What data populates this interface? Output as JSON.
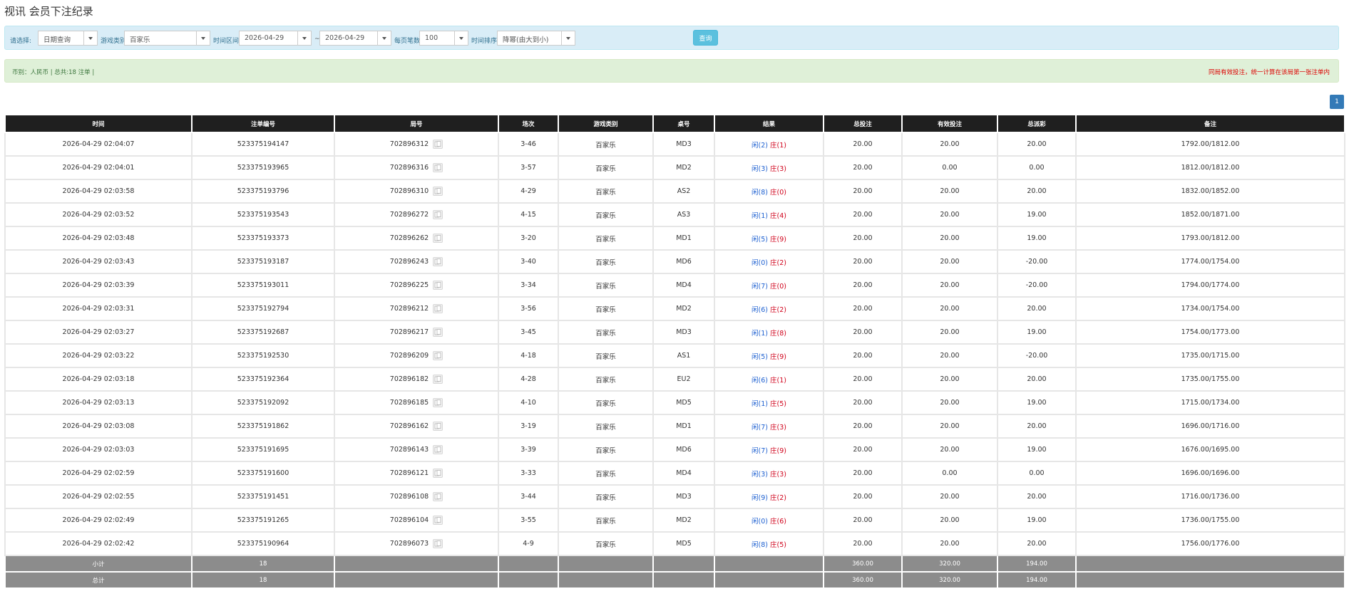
{
  "title": "视讯 会员下注纪录",
  "filter": {
    "select_label": "请选择:",
    "select_value": "日期查询",
    "game_type_label": "游戏类别",
    "game_type_value": "百家乐",
    "time_range_label": "时间区间:",
    "date_from": "2026-04-29",
    "tilde": "~",
    "date_to": "2026-04-29",
    "per_page_label": "每页笔数:",
    "per_page_value": "100",
    "sort_label": "时间排序:",
    "sort_value": "降幂(由大到小)",
    "search_label": "查询"
  },
  "summary": {
    "text": "币别：人民币 | 总共:18 注单 |",
    "notice": "同局有效投注，统一计算在该局第一张注单内"
  },
  "pagination": {
    "current_page": "1"
  },
  "columns": [
    "时间",
    "注单编号",
    "局号",
    "场次",
    "游戏类别",
    "桌号",
    "结果",
    "总投注",
    "有效投注",
    "总派彩",
    "备注"
  ],
  "rows": [
    {
      "time": "2026-04-29 02:04:07",
      "bet_no": "523375194147",
      "round": "702896312",
      "session": "3-46",
      "game": "百家乐",
      "table": "MD3",
      "xian": "闲(2)",
      "zhuang": "庄(1)",
      "total_bet": "20.00",
      "valid_bet": "20.00",
      "payout": "20.00",
      "payout_neg": false,
      "note": "1792.00/1812.00"
    },
    {
      "time": "2026-04-29 02:04:01",
      "bet_no": "523375193965",
      "round": "702896316",
      "session": "3-57",
      "game": "百家乐",
      "table": "MD2",
      "xian": "闲(3)",
      "zhuang": "庄(3)",
      "total_bet": "20.00",
      "valid_bet": "0.00",
      "payout": "0.00",
      "payout_neg": false,
      "note": "1812.00/1812.00"
    },
    {
      "time": "2026-04-29 02:03:58",
      "bet_no": "523375193796",
      "round": "702896310",
      "session": "4-29",
      "game": "百家乐",
      "table": "AS2",
      "xian": "闲(8)",
      "zhuang": "庄(0)",
      "total_bet": "20.00",
      "valid_bet": "20.00",
      "payout": "20.00",
      "payout_neg": false,
      "note": "1832.00/1852.00"
    },
    {
      "time": "2026-04-29 02:03:52",
      "bet_no": "523375193543",
      "round": "702896272",
      "session": "4-15",
      "game": "百家乐",
      "table": "AS3",
      "xian": "闲(1)",
      "zhuang": "庄(4)",
      "total_bet": "20.00",
      "valid_bet": "20.00",
      "payout": "19.00",
      "payout_neg": false,
      "note": "1852.00/1871.00"
    },
    {
      "time": "2026-04-29 02:03:48",
      "bet_no": "523375193373",
      "round": "702896262",
      "session": "3-20",
      "game": "百家乐",
      "table": "MD1",
      "xian": "闲(5)",
      "zhuang": "庄(9)",
      "total_bet": "20.00",
      "valid_bet": "20.00",
      "payout": "19.00",
      "payout_neg": false,
      "note": "1793.00/1812.00"
    },
    {
      "time": "2026-04-29 02:03:43",
      "bet_no": "523375193187",
      "round": "702896243",
      "session": "3-40",
      "game": "百家乐",
      "table": "MD6",
      "xian": "闲(0)",
      "zhuang": "庄(2)",
      "total_bet": "20.00",
      "valid_bet": "20.00",
      "payout": "-20.00",
      "payout_neg": true,
      "note": "1774.00/1754.00"
    },
    {
      "time": "2026-04-29 02:03:39",
      "bet_no": "523375193011",
      "round": "702896225",
      "session": "3-34",
      "game": "百家乐",
      "table": "MD4",
      "xian": "闲(7)",
      "zhuang": "庄(0)",
      "total_bet": "20.00",
      "valid_bet": "20.00",
      "payout": "-20.00",
      "payout_neg": true,
      "note": "1794.00/1774.00"
    },
    {
      "time": "2026-04-29 02:03:31",
      "bet_no": "523375192794",
      "round": "702896212",
      "session": "3-56",
      "game": "百家乐",
      "table": "MD2",
      "xian": "闲(6)",
      "zhuang": "庄(2)",
      "total_bet": "20.00",
      "valid_bet": "20.00",
      "payout": "20.00",
      "payout_neg": false,
      "note": "1734.00/1754.00"
    },
    {
      "time": "2026-04-29 02:03:27",
      "bet_no": "523375192687",
      "round": "702896217",
      "session": "3-45",
      "game": "百家乐",
      "table": "MD3",
      "xian": "闲(1)",
      "zhuang": "庄(8)",
      "total_bet": "20.00",
      "valid_bet": "20.00",
      "payout": "19.00",
      "payout_neg": false,
      "note": "1754.00/1773.00"
    },
    {
      "time": "2026-04-29 02:03:22",
      "bet_no": "523375192530",
      "round": "702896209",
      "session": "4-18",
      "game": "百家乐",
      "table": "AS1",
      "xian": "闲(5)",
      "zhuang": "庄(9)",
      "total_bet": "20.00",
      "valid_bet": "20.00",
      "payout": "-20.00",
      "payout_neg": true,
      "note": "1735.00/1715.00"
    },
    {
      "time": "2026-04-29 02:03:18",
      "bet_no": "523375192364",
      "round": "702896182",
      "session": "4-28",
      "game": "百家乐",
      "table": "EU2",
      "xian": "闲(6)",
      "zhuang": "庄(1)",
      "total_bet": "20.00",
      "valid_bet": "20.00",
      "payout": "20.00",
      "payout_neg": false,
      "note": "1735.00/1755.00"
    },
    {
      "time": "2026-04-29 02:03:13",
      "bet_no": "523375192092",
      "round": "702896185",
      "session": "4-10",
      "game": "百家乐",
      "table": "MD5",
      "xian": "闲(1)",
      "zhuang": "庄(5)",
      "total_bet": "20.00",
      "valid_bet": "20.00",
      "payout": "19.00",
      "payout_neg": false,
      "note": "1715.00/1734.00"
    },
    {
      "time": "2026-04-29 02:03:08",
      "bet_no": "523375191862",
      "round": "702896162",
      "session": "3-19",
      "game": "百家乐",
      "table": "MD1",
      "xian": "闲(7)",
      "zhuang": "庄(3)",
      "total_bet": "20.00",
      "valid_bet": "20.00",
      "payout": "20.00",
      "payout_neg": false,
      "note": "1696.00/1716.00"
    },
    {
      "time": "2026-04-29 02:03:03",
      "bet_no": "523375191695",
      "round": "702896143",
      "session": "3-39",
      "game": "百家乐",
      "table": "MD6",
      "xian": "闲(7)",
      "zhuang": "庄(9)",
      "total_bet": "20.00",
      "valid_bet": "20.00",
      "payout": "19.00",
      "payout_neg": false,
      "note": "1676.00/1695.00"
    },
    {
      "time": "2026-04-29 02:02:59",
      "bet_no": "523375191600",
      "round": "702896121",
      "session": "3-33",
      "game": "百家乐",
      "table": "MD4",
      "xian": "闲(3)",
      "zhuang": "庄(3)",
      "total_bet": "20.00",
      "valid_bet": "0.00",
      "payout": "0.00",
      "payout_neg": false,
      "note": "1696.00/1696.00"
    },
    {
      "time": "2026-04-29 02:02:55",
      "bet_no": "523375191451",
      "round": "702896108",
      "session": "3-44",
      "game": "百家乐",
      "table": "MD3",
      "xian": "闲(9)",
      "zhuang": "庄(2)",
      "total_bet": "20.00",
      "valid_bet": "20.00",
      "payout": "20.00",
      "payout_neg": false,
      "note": "1716.00/1736.00"
    },
    {
      "time": "2026-04-29 02:02:49",
      "bet_no": "523375191265",
      "round": "702896104",
      "session": "3-55",
      "game": "百家乐",
      "table": "MD2",
      "xian": "闲(0)",
      "zhuang": "庄(6)",
      "total_bet": "20.00",
      "valid_bet": "20.00",
      "payout": "19.00",
      "payout_neg": false,
      "note": "1736.00/1755.00"
    },
    {
      "time": "2026-04-29 02:02:42",
      "bet_no": "523375190964",
      "round": "702896073",
      "session": "4-9",
      "game": "百家乐",
      "table": "MD5",
      "xian": "闲(8)",
      "zhuang": "庄(5)",
      "total_bet": "20.00",
      "valid_bet": "20.00",
      "payout": "20.00",
      "payout_neg": false,
      "note": "1756.00/1776.00"
    }
  ],
  "subtotal": {
    "label": "小计",
    "count": "18",
    "total_bet": "360.00",
    "valid_bet": "320.00",
    "payout": "194.00"
  },
  "grandtotal": {
    "label": "总计",
    "count": "18",
    "total_bet": "360.00",
    "valid_bet": "320.00",
    "payout": "194.00"
  },
  "colors": {
    "header_bg": "#1f1f1f",
    "blue_link": "#1c5fd0",
    "negative": "#d0021b",
    "total_bg": "#8c8c8c",
    "filter_bg": "#d9edf7",
    "summary_bg": "#dff0d8"
  },
  "icons": {
    "detail_icon": "card-detail-icon",
    "dropdown_icon": "chevron-down-icon"
  }
}
